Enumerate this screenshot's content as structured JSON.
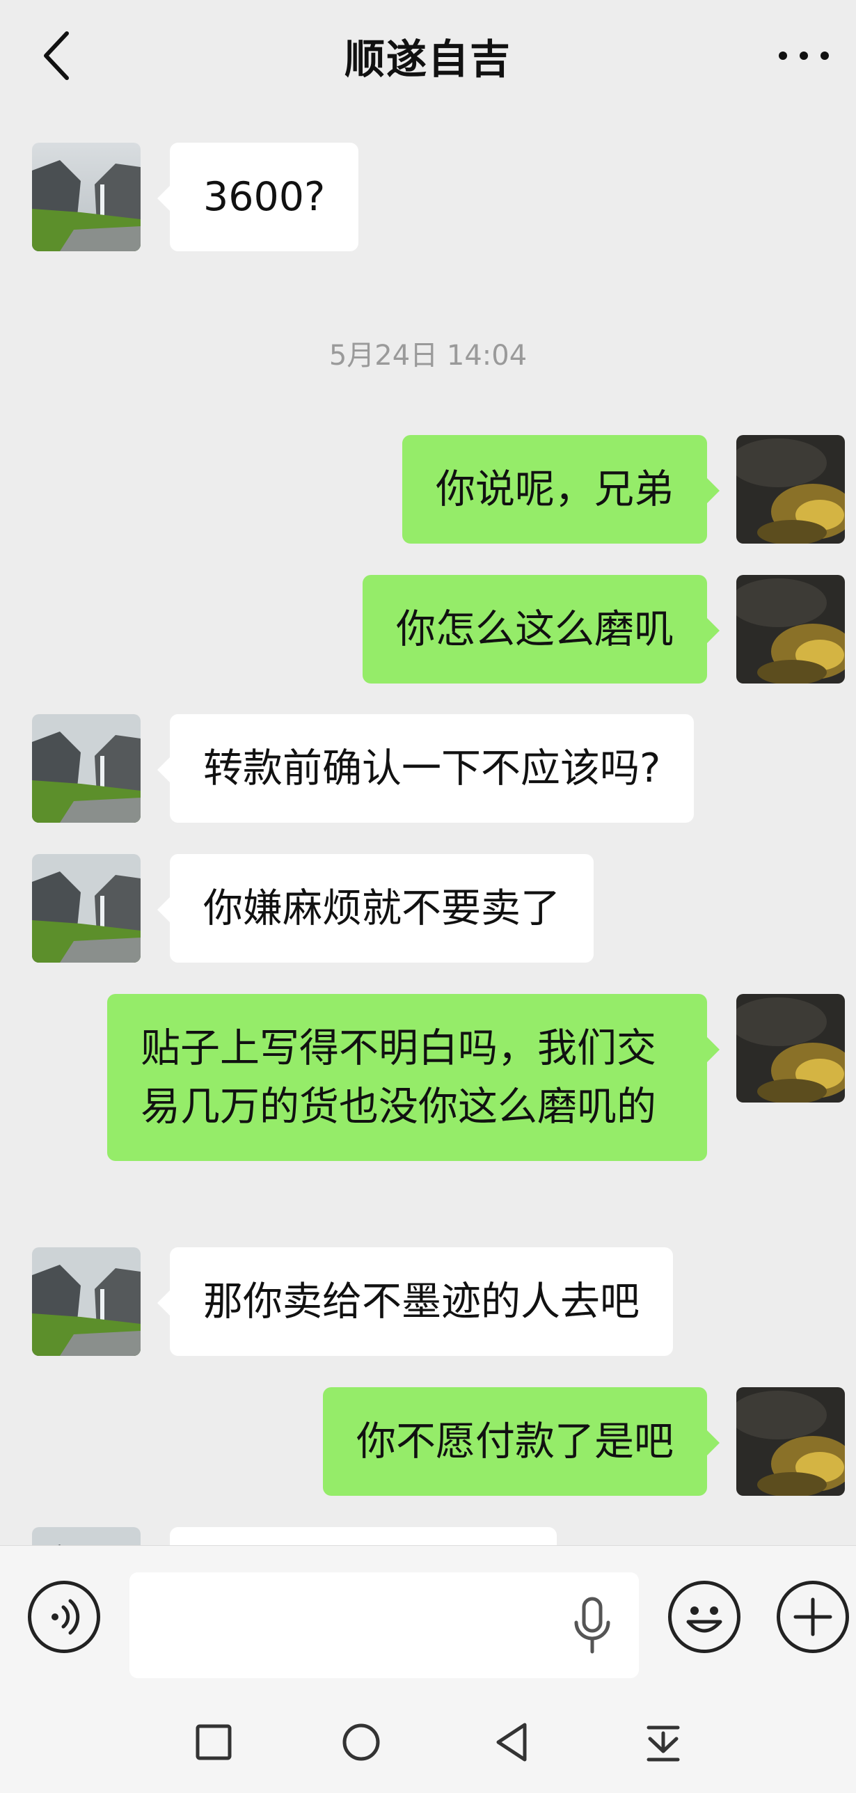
{
  "header": {
    "title": "顺遂自吉",
    "back_icon": "chevron-left-icon",
    "more_icon": "more-dots-icon"
  },
  "messages": [
    {
      "side": "in",
      "text": "3600?"
    },
    {
      "type": "time",
      "text": "5月24日 14:04"
    },
    {
      "side": "out",
      "text": "你说呢，兄弟"
    },
    {
      "side": "out",
      "text": "你怎么这么磨叽"
    },
    {
      "side": "in",
      "text": "转款前确认一下不应该吗?"
    },
    {
      "side": "in",
      "text": "你嫌麻烦就不要卖了"
    },
    {
      "side": "out",
      "text": "贴子上写得不明白吗，我们交易几万的货也没你这么磨叽的"
    },
    {
      "side": "in",
      "text": "那你卖给不墨迹的人去吧"
    },
    {
      "side": "out",
      "text": "你不愿付款了是吧"
    }
  ],
  "input_bar": {
    "placeholder": "",
    "voice_icon": "voice-icon",
    "mic_icon": "microphone-icon",
    "emoji_icon": "emoji-icon",
    "plus_icon": "plus-icon"
  },
  "nav_bar": {
    "icons": [
      "recent-apps-icon",
      "home-icon",
      "back-icon",
      "notification-pulldown-icon"
    ]
  },
  "colors": {
    "outgoing_bubble": "#95ec69",
    "incoming_bubble": "#ffffff",
    "background": "#ededed"
  }
}
